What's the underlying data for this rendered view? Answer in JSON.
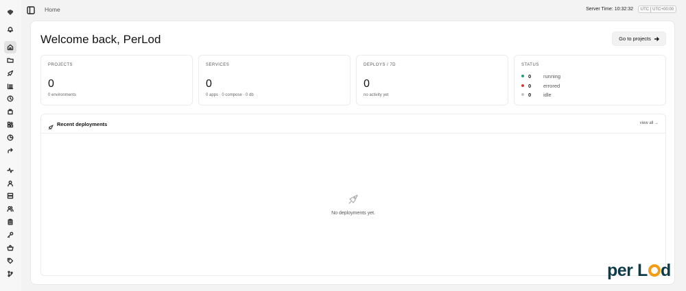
{
  "topbar": {
    "breadcrumb": "Home",
    "server_time_label": "Server Time:",
    "server_time": "10:32:32",
    "tz_short": "UTC",
    "tz_offset": "UTC+00:00"
  },
  "sidebar": {
    "items": [
      {
        "icon": "logo-icon"
      },
      {
        "icon": "bell-icon"
      },
      {
        "icon": "home-icon",
        "active": true
      },
      {
        "icon": "folder-icon"
      },
      {
        "icon": "rocket-icon"
      },
      {
        "icon": "list-icon"
      },
      {
        "icon": "clock-icon"
      },
      {
        "icon": "package-icon"
      },
      {
        "icon": "templates-icon"
      },
      {
        "icon": "pie-chart-icon"
      },
      {
        "icon": "redirect-icon"
      },
      {
        "icon": "activity-icon"
      },
      {
        "icon": "user-icon"
      },
      {
        "icon": "server-icon"
      },
      {
        "icon": "users-icon"
      },
      {
        "icon": "clipboard-icon"
      },
      {
        "icon": "key-icon"
      },
      {
        "icon": "basket-icon"
      },
      {
        "icon": "tag-icon"
      },
      {
        "icon": "git-branch-icon"
      }
    ]
  },
  "main": {
    "title": "Welcome back, PerLod",
    "go_button": "Go to projects",
    "cards": [
      {
        "label": "PROJECTS",
        "value": "0",
        "sub": "0 environments"
      },
      {
        "label": "SERVICES",
        "value": "0",
        "sub": "0 apps · 0 compose · 0 db"
      },
      {
        "label": "DEPLOYS / 7D",
        "value": "0",
        "sub": "no activity yet"
      }
    ],
    "status": {
      "label": "STATUS",
      "rows": [
        {
          "count": "0",
          "name": "running",
          "color": "#22a06b"
        },
        {
          "count": "0",
          "name": "errored",
          "color": "#d63838"
        },
        {
          "count": "0",
          "name": "idle",
          "color": "#c4c4c4"
        }
      ]
    },
    "recent": {
      "title": "Recent deployments",
      "view_all": "view all →",
      "empty": "No deployments yet."
    }
  },
  "watermark": {
    "brand": "perLod",
    "colors": {
      "dark": "#0d3b4a",
      "accent": "#f39c12"
    }
  }
}
